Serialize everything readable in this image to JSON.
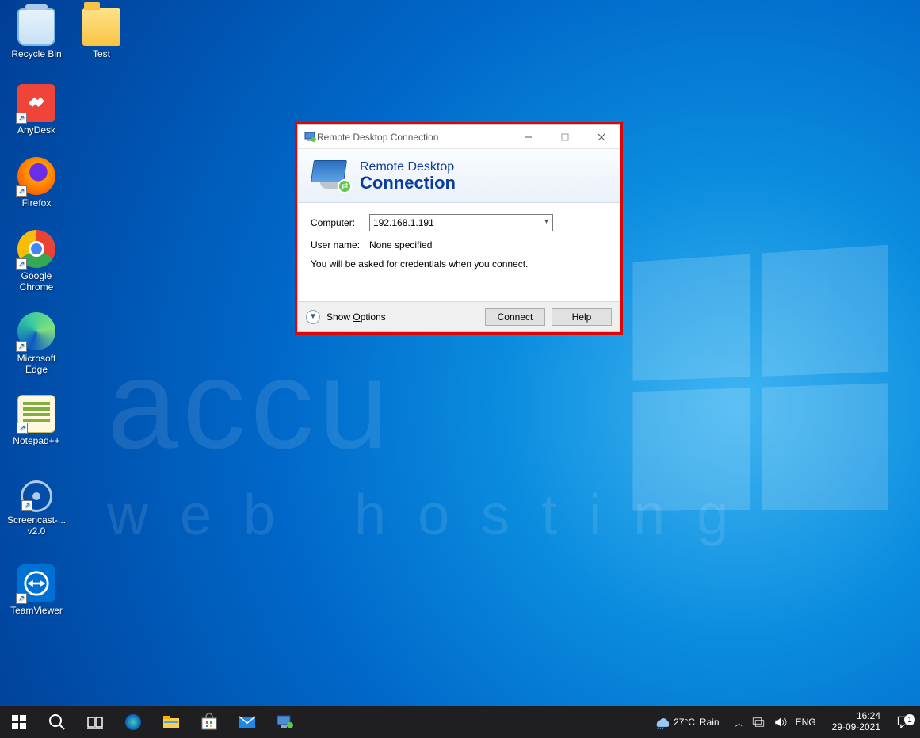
{
  "desktop": {
    "icons": [
      {
        "label": "Recycle Bin"
      },
      {
        "label": "Test"
      },
      {
        "label": "AnyDesk"
      },
      {
        "label": "Firefox"
      },
      {
        "label": "Google Chrome"
      },
      {
        "label": "Microsoft Edge"
      },
      {
        "label": "Notepad++"
      },
      {
        "label": "Screencast-... v2.0"
      },
      {
        "label": "TeamViewer"
      }
    ]
  },
  "watermark": {
    "line1": "accu",
    "line2": "web hosting"
  },
  "rdc": {
    "window_title": "Remote Desktop Connection",
    "header_line1": "Remote Desktop",
    "header_line2": "Connection",
    "computer_label": "Computer:",
    "computer_value": "192.168.1.191",
    "username_label": "User name:",
    "username_value": "None specified",
    "note": "You will be asked for credentials when you connect.",
    "show_options_prefix": "Show ",
    "show_options_u": "O",
    "show_options_suffix": "ptions",
    "connect_label": "Connect",
    "help_label": "Help"
  },
  "taskbar": {
    "weather_temp": "27°C",
    "weather_cond": "Rain",
    "lang": "ENG",
    "time": "16:24",
    "date": "29-09-2021",
    "notif_count": "1"
  }
}
